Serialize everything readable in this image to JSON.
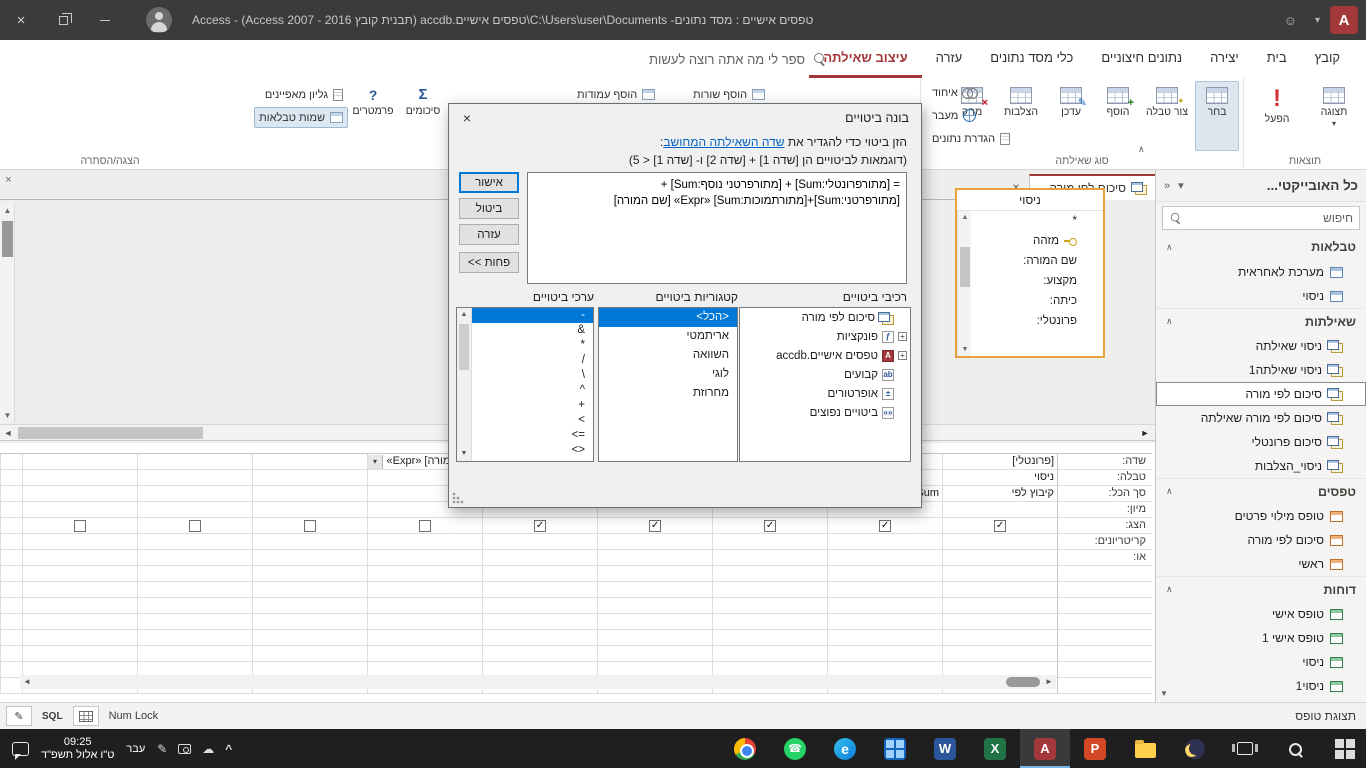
{
  "titlebar": {
    "title": "טפסים אישיים : מסד נתונים- C:\\Users\\user\\Documents\\טפסים אישיים.accdb (תבנית קובץ Access 2007 - 2016) - Access",
    "app_logo_letter": "A"
  },
  "ribbon": {
    "tellme": "ספר לי מה אתה רוצה לעשות",
    "tabs": [
      {
        "label": "קובץ"
      },
      {
        "label": "בית"
      },
      {
        "label": "יצירה"
      },
      {
        "label": "נתונים חיצוניים"
      },
      {
        "label": "כלי מסד נתונים"
      },
      {
        "label": "עזרה"
      },
      {
        "label": "עיצוב שאילתה",
        "active": true
      }
    ],
    "groups": {
      "results": {
        "label": "תוצאות",
        "view": "תצוגה",
        "run": "הפעל"
      },
      "query_type": {
        "label": "סוג שאילתה",
        "select": "בחר",
        "make_table": "צור טבלה",
        "append": "הוסף",
        "update": "עדכן",
        "crosstab": "הצלבות",
        "delete": "מחק",
        "union": "איחוד",
        "pass_through": "מעבר",
        "data_definition": "הגדרת נתונים"
      },
      "query_setup": {
        "insert_rows": "הוסף שורות",
        "insert_columns": "הוסף עמודות"
      },
      "show_hide": {
        "label": "הצגה/הסתרה",
        "totals": "סיכומים",
        "parameters": "פרמטרים",
        "property_sheet": "גליון מאפיינים",
        "table_names": "שמות טבלאות"
      }
    }
  },
  "dialog": {
    "title": "בונה ביטויים",
    "instruction": {
      "prefix": "הזן ביטוי כדי להגדיר את ",
      "link": "שדה השאילתה המחושב",
      "suffix": ":"
    },
    "example": "(דוגמאות לביטויים הן [שדה 1] + [שדה 2] ו- [שדה 1] < 5)",
    "expression": {
      "line1": "= [מתורפרונטלי:Sum] + [מתורפרטני נוסף:Sum] +",
      "line2": "[מתורפרטני:Sum]+[מתורתמוכות:Sum] «Expr» [שם המורה]"
    },
    "buttons": {
      "ok": "אישור",
      "cancel": "ביטול",
      "help": "עזרה",
      "less": "<< פחות"
    },
    "elements": {
      "header": "רכיבי ביטויים",
      "items": [
        {
          "label": "סיכום לפי מורה",
          "icon": "query-icon"
        },
        {
          "label": "פונקציות",
          "icon": "functions-icon",
          "expandable": true
        },
        {
          "label": "טפסים אישיים.accdb",
          "icon": "database-icon",
          "expandable": true
        },
        {
          "label": "קבועים",
          "icon": "constants-icon"
        },
        {
          "label": "אופרטורים",
          "icon": "operators-icon"
        },
        {
          "label": "ביטויים נפוצים",
          "icon": "common-expressions-icon"
        }
      ]
    },
    "categories": {
      "header": "קטגוריות ביטויים",
      "items": [
        {
          "label": "<הכל>",
          "selected": true
        },
        {
          "label": "אריתמטי"
        },
        {
          "label": "השוואה"
        },
        {
          "label": "לוגי"
        },
        {
          "label": "מחרוזת"
        }
      ]
    },
    "values": {
      "header": "ערכי ביטויים",
      "items": [
        {
          "label": "-",
          "selected": true
        },
        {
          "label": "&"
        },
        {
          "label": "*"
        },
        {
          "label": "/"
        },
        {
          "label": "\\"
        },
        {
          "label": "^"
        },
        {
          "label": "+"
        },
        {
          "label": ">"
        },
        {
          "label": "=>"
        },
        {
          "label": "<>"
        },
        {
          "label": "="
        }
      ]
    }
  },
  "nav": {
    "title": "כל האובייקטי...",
    "search": "חיפוש",
    "sections": [
      {
        "header": "טבלאות",
        "items": [
          {
            "label": "מערכת לאחראית"
          },
          {
            "label": "ניסוי"
          }
        ]
      },
      {
        "header": "שאילתות",
        "items": [
          {
            "label": "ניסוי שאילתה"
          },
          {
            "label": "ניסוי שאילתה1"
          },
          {
            "label": "סיכום לפי מורה",
            "selected": true
          },
          {
            "label": "סיכום לפי מורה שאילתה"
          },
          {
            "label": "סיכום פרונטלי"
          },
          {
            "label": "ניסוי_הצלבות"
          }
        ]
      },
      {
        "header": "טפסים",
        "items": [
          {
            "label": "טופס מילוי פרטים"
          },
          {
            "label": "סיכום לפי מורה"
          },
          {
            "label": "ראשי"
          }
        ]
      },
      {
        "header": "דוחות",
        "items": [
          {
            "label": "טופס אישי"
          },
          {
            "label": "טופס אישי 1"
          },
          {
            "label": "ניסוי"
          },
          {
            "label": "ניסוי1"
          }
        ]
      }
    ]
  },
  "doc": {
    "tab": "סיכום לפי מורה",
    "field_list": {
      "title": "ניסוי",
      "fields": [
        "*",
        "מזהה",
        "שם המורה:",
        "מקצוע:",
        "כיתה:",
        "פרונטלי:"
      ]
    },
    "grid": {
      "row_labels": [
        "שדה:",
        "טבלה:",
        "סך הכל:",
        "מיון:",
        "הצג:",
        "קריטריונים:",
        "או:"
      ],
      "columns": [
        {
          "field": "[פרונטלי]",
          "table": "ניסוי",
          "total": "קיבוץ לפי",
          "show": true
        },
        {
          "field": "",
          "table": "",
          "total": "Sum",
          "show": true
        },
        {
          "show": true
        },
        {
          "show": true
        },
        {
          "show": true
        },
        {
          "field": "[שם המורה] «Expr»",
          "show": false,
          "dropdown": true
        },
        {
          "show": false
        },
        {
          "show": false
        },
        {
          "show": false
        }
      ]
    }
  },
  "statusbar": {
    "view": "תצוגת טופס",
    "sql": "SQL",
    "num_lock": "Num Lock"
  },
  "taskbar": {
    "time": "09:25",
    "date": "ט\"ו אלול תשפ\"ד",
    "lang": "עבר",
    "apps": [
      {
        "id": "chrome"
      },
      {
        "id": "whatsapp"
      },
      {
        "id": "edge"
      },
      {
        "id": "app-tiles"
      },
      {
        "id": "word",
        "glyph": "W"
      },
      {
        "id": "excel",
        "glyph": "X"
      },
      {
        "id": "access",
        "glyph": "A",
        "active": true
      },
      {
        "id": "powerpoint",
        "glyph": "P"
      },
      {
        "id": "file-explorer"
      },
      {
        "id": "moon"
      }
    ]
  }
}
